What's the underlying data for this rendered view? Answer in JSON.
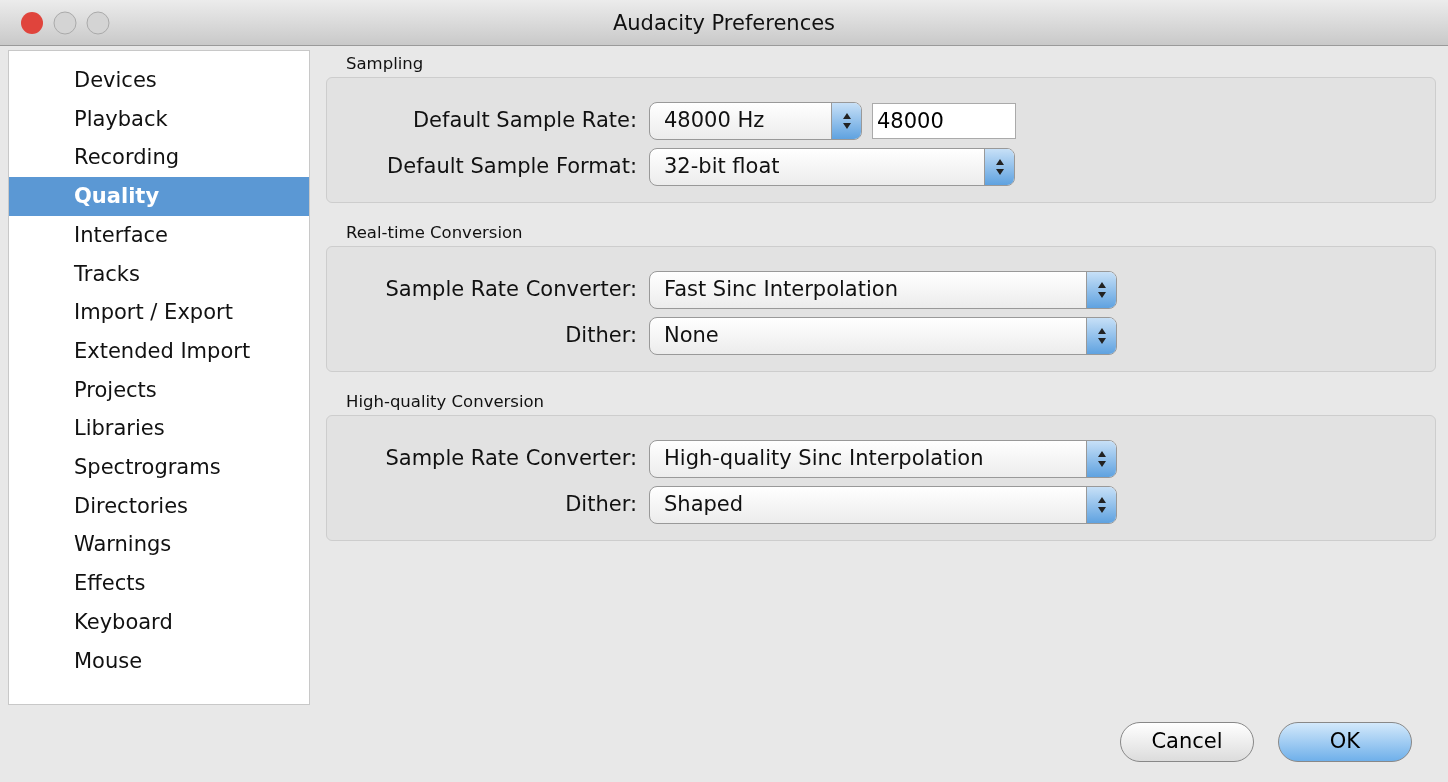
{
  "window": {
    "title": "Audacity Preferences"
  },
  "sidebar": {
    "items": [
      {
        "label": "Devices",
        "selected": false
      },
      {
        "label": "Playback",
        "selected": false
      },
      {
        "label": "Recording",
        "selected": false
      },
      {
        "label": "Quality",
        "selected": true
      },
      {
        "label": "Interface",
        "selected": false
      },
      {
        "label": "Tracks",
        "selected": false
      },
      {
        "label": "Import / Export",
        "selected": false
      },
      {
        "label": "Extended Import",
        "selected": false
      },
      {
        "label": "Projects",
        "selected": false
      },
      {
        "label": "Libraries",
        "selected": false
      },
      {
        "label": "Spectrograms",
        "selected": false
      },
      {
        "label": "Directories",
        "selected": false
      },
      {
        "label": "Warnings",
        "selected": false
      },
      {
        "label": "Effects",
        "selected": false
      },
      {
        "label": "Keyboard",
        "selected": false
      },
      {
        "label": "Mouse",
        "selected": false
      }
    ]
  },
  "sections": [
    {
      "title": "Sampling",
      "rows": [
        {
          "label": "Default Sample Rate:",
          "controls": [
            {
              "kind": "popup",
              "value": "48000 Hz"
            },
            {
              "kind": "text",
              "value": "48000"
            }
          ]
        },
        {
          "label": "Default Sample Format:",
          "controls": [
            {
              "kind": "popup",
              "value": "32-bit float"
            }
          ]
        }
      ]
    },
    {
      "title": "Real-time Conversion",
      "rows": [
        {
          "label": "Sample Rate Converter:",
          "controls": [
            {
              "kind": "popup",
              "value": "Fast Sinc Interpolation"
            }
          ]
        },
        {
          "label": "Dither:",
          "controls": [
            {
              "kind": "popup",
              "value": "None"
            }
          ]
        }
      ]
    },
    {
      "title": "High-quality Conversion",
      "rows": [
        {
          "label": "Sample Rate Converter:",
          "controls": [
            {
              "kind": "popup",
              "value": "High-quality Sinc Interpolation"
            }
          ]
        },
        {
          "label": "Dither:",
          "controls": [
            {
              "kind": "popup",
              "value": "Shaped"
            }
          ]
        }
      ]
    }
  ],
  "buttons": [
    {
      "label": "Cancel",
      "kind": "normal"
    },
    {
      "label": "OK",
      "kind": "default"
    }
  ]
}
